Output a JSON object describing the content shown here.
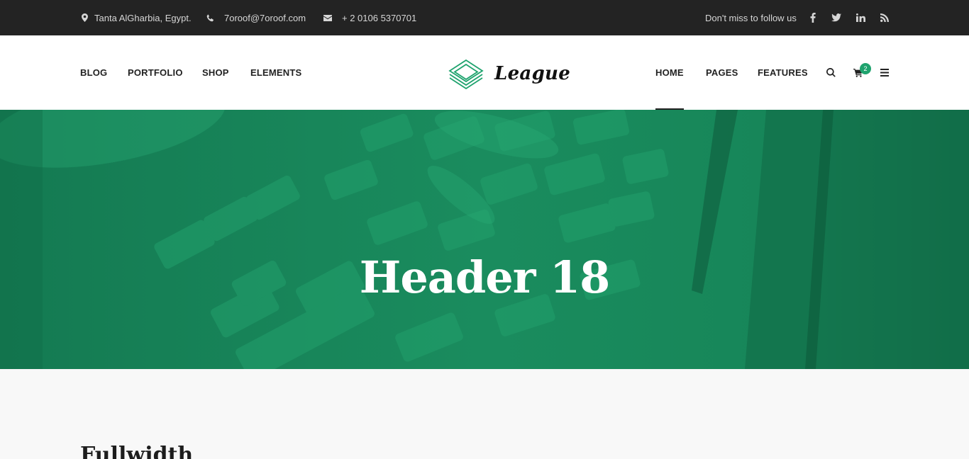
{
  "topbar": {
    "location": "Tanta AlGharbia, Egypt.",
    "email": "7oroof@7oroof.com",
    "phone": "+ 2 0106 5370701",
    "follow_text": "Don't miss to follow us",
    "social_icons": [
      "facebook-icon",
      "twitter-icon",
      "linkedin-icon",
      "rss-icon"
    ]
  },
  "nav_left": {
    "items": [
      {
        "label": "BLOG"
      },
      {
        "label": "PORTFOLIO"
      },
      {
        "label": "SHOP"
      },
      {
        "label": "ELEMENTS"
      }
    ]
  },
  "logo": {
    "text": "League"
  },
  "nav_right": {
    "items": [
      {
        "label": "HOME",
        "active": true
      },
      {
        "label": "PAGES"
      },
      {
        "label": "FEATURES"
      }
    ]
  },
  "cart": {
    "count": "2"
  },
  "hero": {
    "title": "Header 18"
  },
  "content": {
    "section_title": "Fullwidth"
  },
  "colors": {
    "accent": "#1fa36e",
    "topbar_bg": "#232323",
    "hero_overlay": "#17855a"
  }
}
